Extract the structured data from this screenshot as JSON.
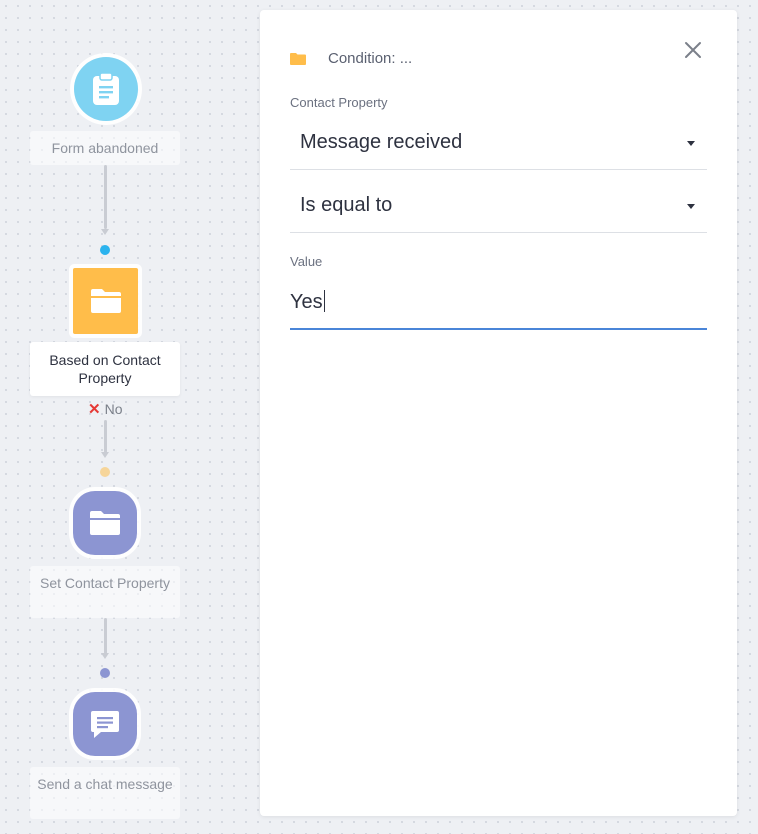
{
  "flow": {
    "nodes": [
      {
        "label": "Form abandoned",
        "icon": "clipboard-icon",
        "color": "#7fd3f2"
      },
      {
        "label": "Based on Contact Property",
        "icon": "folder-icon",
        "color": "#ffbd4a"
      },
      {
        "label": "Set Contact Property",
        "icon": "folder-icon",
        "color": "#8c95d2"
      },
      {
        "label": "Send a chat message",
        "icon": "chat-icon",
        "color": "#8c95d2"
      }
    ],
    "branch_label": "No",
    "connector_colors": [
      "#2bb3ee",
      "#f6d59a",
      "#8c95d2"
    ]
  },
  "panel": {
    "title": "Condition: ...",
    "contact_property_label": "Contact Property",
    "property_value": "Message received",
    "operator_value": "Is equal to",
    "value_label": "Value",
    "value_input": "Yes",
    "accent_color": "#4a85d8"
  }
}
